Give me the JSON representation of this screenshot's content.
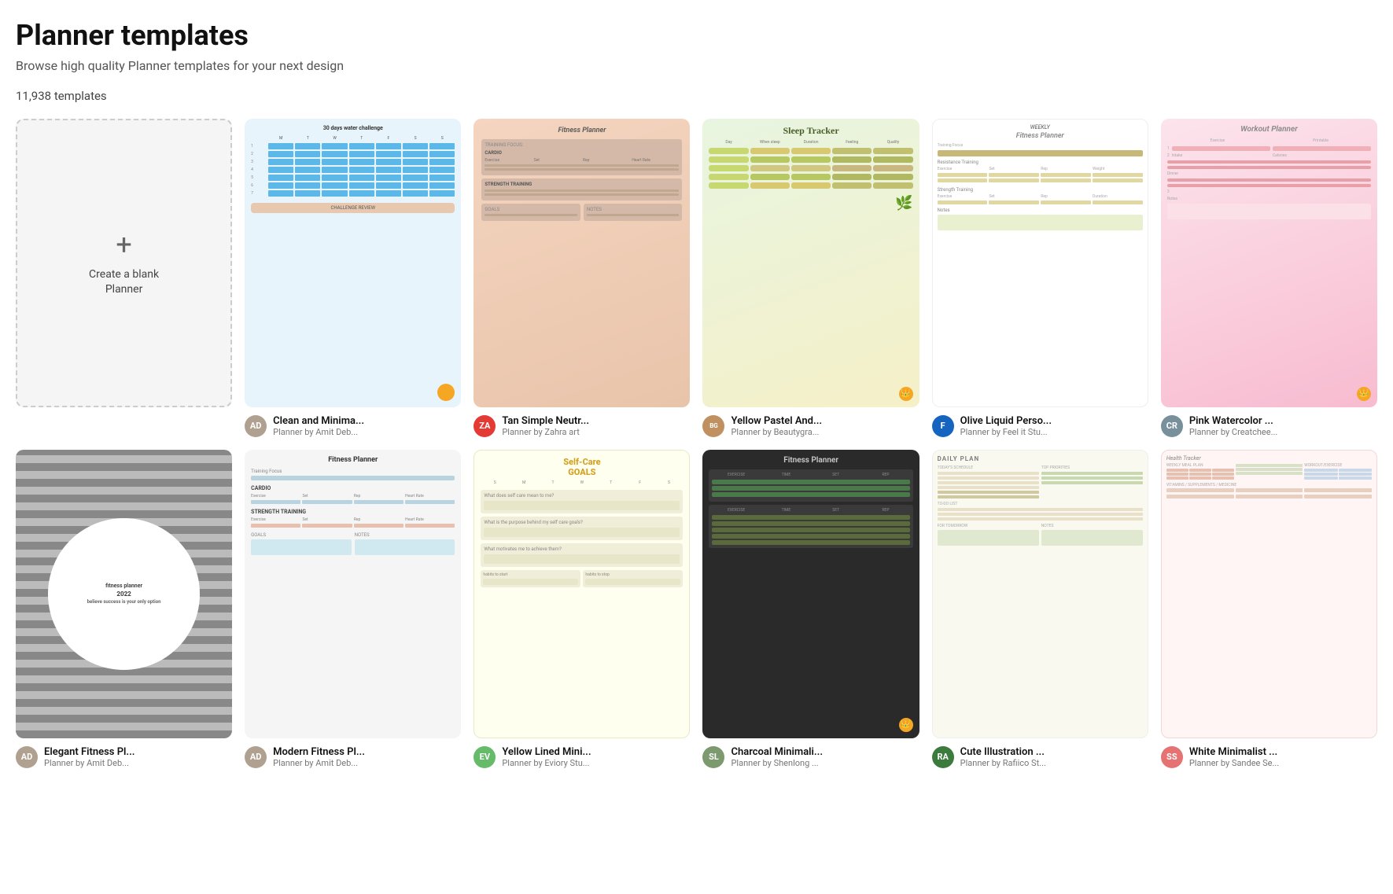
{
  "page": {
    "title": "Planner templates",
    "subtitle": "Browse high quality Planner templates for your next design",
    "template_count": "11,938 templates"
  },
  "blank_card": {
    "label": "Create a blank\nPlanner",
    "plus": "+"
  },
  "templates": [
    {
      "id": "water-challenge",
      "title": "Clean and Minima...",
      "meta": "Planner by Amit Deb...",
      "avatar_color": "#b0a090",
      "avatar_text": "AD",
      "has_crown": false,
      "style": "water"
    },
    {
      "id": "fitness-pink",
      "title": "Tan Simple Neutr...",
      "meta": "Planner by Zahra art",
      "avatar_color": "#e53935",
      "avatar_text": "ZA",
      "has_crown": false,
      "style": "fitness-pink"
    },
    {
      "id": "sleep-tracker",
      "title": "Yellow Pastel And...",
      "meta": "Planner by Beautygra...",
      "avatar_color": "#c09060",
      "avatar_text": "BG",
      "has_crown": true,
      "style": "sleep"
    },
    {
      "id": "weekly-fitness",
      "title": "Olive Liquid Perso...",
      "meta": "Planner by Feel it Stu...",
      "avatar_color": "#1565C0",
      "avatar_text": "F",
      "has_crown": false,
      "style": "weekly"
    },
    {
      "id": "workout-planner",
      "title": "Pink Watercolor ...",
      "meta": "Planner by Creatchee...",
      "avatar_color": "#78909c",
      "avatar_text": "CR",
      "has_crown": true,
      "style": "workout"
    },
    {
      "id": "elegant-fitness",
      "title": "Elegant Fitness Pl...",
      "meta": "Planner by Amit Deb...",
      "avatar_color": "#b0a090",
      "avatar_text": "AD",
      "has_crown": false,
      "style": "elegant"
    },
    {
      "id": "modern-fitness",
      "title": "Modern Fitness Pl...",
      "meta": "Planner by Amit Deb...",
      "avatar_color": "#b0a090",
      "avatar_text": "AD",
      "has_crown": false,
      "style": "modern"
    },
    {
      "id": "selfcare-goals",
      "title": "Yellow Lined Mini...",
      "meta": "Planner by Eviory Stu...",
      "avatar_color": "#66bb6a",
      "avatar_text": "EV",
      "has_crown": false,
      "style": "selfcare"
    },
    {
      "id": "charcoal-fitness",
      "title": "Charcoal Minimali...",
      "meta": "Planner by Shenlong ...",
      "avatar_color": "#7c9a6e",
      "avatar_text": "SL",
      "has_crown": true,
      "style": "charcoal"
    },
    {
      "id": "daily-plan",
      "title": "Cute Illustration ...",
      "meta": "Planner by Rafiico St...",
      "avatar_color": "#3d7a3d",
      "avatar_text": "RA",
      "has_crown": false,
      "style": "daily"
    },
    {
      "id": "health-tracker",
      "title": "White Minimalist ...",
      "meta": "Planner by Sandee Se...",
      "avatar_color": "#e57373",
      "avatar_text": "SS",
      "has_crown": false,
      "style": "health"
    }
  ]
}
